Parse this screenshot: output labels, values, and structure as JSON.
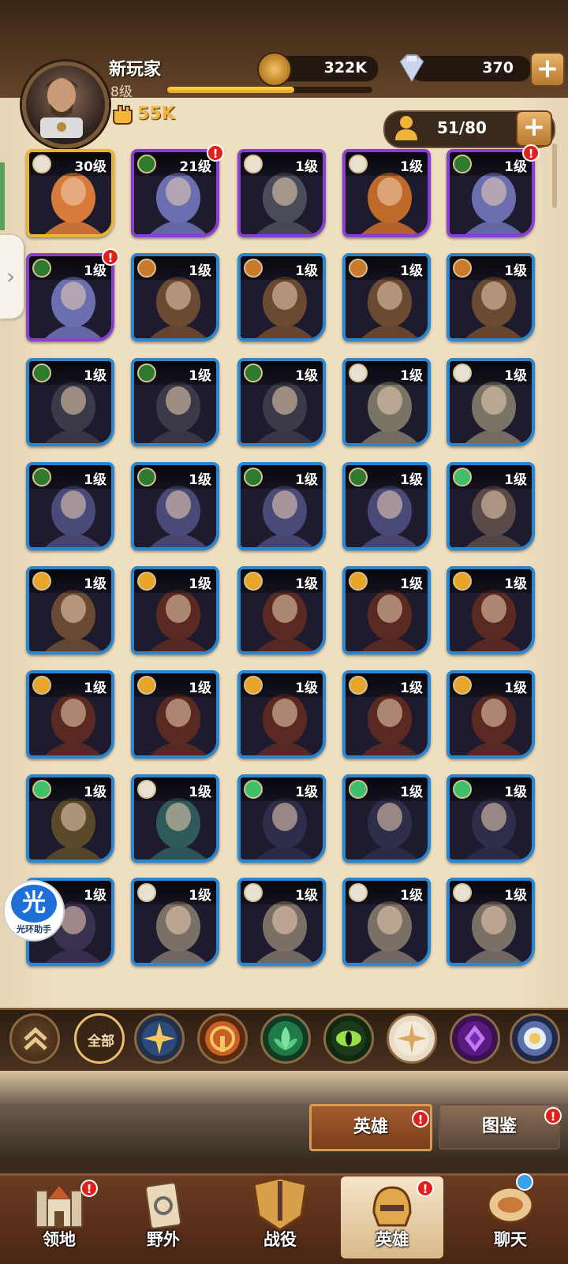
{
  "player": {
    "name": "新玩家",
    "level": "8级",
    "xp_progress": 0.62,
    "power": "55K"
  },
  "resources": {
    "gold": "322K",
    "gems": "370",
    "plus": "+"
  },
  "hero_capacity": "51/80",
  "colors": {
    "blue_frame": "#2b86d0",
    "purple_frame": "#8a3fd0",
    "gold_frame": "#e9b431",
    "panel_bg": "#efdfc1",
    "alert_red": "#e0201c"
  },
  "factions": {
    "lightbearer": {
      "color": "#e8a52a",
      "icon": "sun-cog-icon"
    },
    "wilder": {
      "color": "#3fbf6a",
      "icon": "leaf-icon"
    },
    "graveborn": {
      "color": "#2e7a2e",
      "icon": "eye-icon"
    },
    "maulers": {
      "color": "#c87a2a",
      "icon": "fist-icon"
    },
    "celestial": {
      "color": "#e8e0d0",
      "icon": "star-icon"
    },
    "hypogean": {
      "color": "#8d3fd0",
      "icon": "demon-icon"
    },
    "dimensional": {
      "color": "#5b6fa8",
      "icon": "gear-icon"
    }
  },
  "heroes": [
    {
      "level": "30级",
      "rarity": "gold",
      "faction": "celestial",
      "alert": false,
      "portrait": "#d87a3a"
    },
    {
      "level": "21级",
      "rarity": "purple",
      "faction": "graveborn",
      "alert": true,
      "portrait": "#6b6fb0"
    },
    {
      "level": "1级",
      "rarity": "purple",
      "faction": "celestial",
      "alert": false,
      "portrait": "#4a4d58"
    },
    {
      "level": "1级",
      "rarity": "purple",
      "faction": "celestial",
      "alert": false,
      "portrait": "#c06a2a"
    },
    {
      "level": "1级",
      "rarity": "purple",
      "faction": "graveborn",
      "alert": true,
      "portrait": "#6b6fb0"
    },
    {
      "level": "1级",
      "rarity": "purple",
      "faction": "graveborn",
      "alert": true,
      "portrait": "#6b6fb0"
    },
    {
      "level": "1级",
      "rarity": "blue",
      "faction": "maulers",
      "alert": false,
      "portrait": "#6b4a32"
    },
    {
      "level": "1级",
      "rarity": "blue",
      "faction": "maulers",
      "alert": false,
      "portrait": "#6b4a32"
    },
    {
      "level": "1级",
      "rarity": "blue",
      "faction": "maulers",
      "alert": false,
      "portrait": "#6b4a32"
    },
    {
      "level": "1级",
      "rarity": "blue",
      "faction": "maulers",
      "alert": false,
      "portrait": "#6b4a32"
    },
    {
      "level": "1级",
      "rarity": "blue",
      "faction": "graveborn",
      "alert": false,
      "portrait": "#3a3a48"
    },
    {
      "level": "1级",
      "rarity": "blue",
      "faction": "graveborn",
      "alert": false,
      "portrait": "#3a3a48"
    },
    {
      "level": "1级",
      "rarity": "blue",
      "faction": "graveborn",
      "alert": false,
      "portrait": "#3a3a48"
    },
    {
      "level": "1级",
      "rarity": "blue",
      "faction": "celestial",
      "alert": false,
      "portrait": "#7a7466"
    },
    {
      "level": "1级",
      "rarity": "blue",
      "faction": "celestial",
      "alert": false,
      "portrait": "#7a7466"
    },
    {
      "level": "1级",
      "rarity": "blue",
      "faction": "graveborn",
      "alert": false,
      "portrait": "#4a4a78"
    },
    {
      "level": "1级",
      "rarity": "blue",
      "faction": "graveborn",
      "alert": false,
      "portrait": "#4a4a78"
    },
    {
      "level": "1级",
      "rarity": "blue",
      "faction": "graveborn",
      "alert": false,
      "portrait": "#4a4a78"
    },
    {
      "level": "1级",
      "rarity": "blue",
      "faction": "graveborn",
      "alert": false,
      "portrait": "#4a4a78"
    },
    {
      "level": "1级",
      "rarity": "blue",
      "faction": "wilder",
      "alert": false,
      "portrait": "#5a4a48"
    },
    {
      "level": "1级",
      "rarity": "blue",
      "faction": "lightbearer",
      "alert": false,
      "portrait": "#6a4a34"
    },
    {
      "level": "1级",
      "rarity": "blue",
      "faction": "lightbearer",
      "alert": false,
      "portrait": "#5a2a22"
    },
    {
      "level": "1级",
      "rarity": "blue",
      "faction": "lightbearer",
      "alert": false,
      "portrait": "#5a2a22"
    },
    {
      "level": "1级",
      "rarity": "blue",
      "faction": "lightbearer",
      "alert": false,
      "portrait": "#5a2a22"
    },
    {
      "level": "1级",
      "rarity": "blue",
      "faction": "lightbearer",
      "alert": false,
      "portrait": "#5a2a22"
    },
    {
      "level": "1级",
      "rarity": "blue",
      "faction": "lightbearer",
      "alert": false,
      "portrait": "#5a2a22"
    },
    {
      "level": "1级",
      "rarity": "blue",
      "faction": "lightbearer",
      "alert": false,
      "portrait": "#5a2a22"
    },
    {
      "level": "1级",
      "rarity": "blue",
      "faction": "lightbearer",
      "alert": false,
      "portrait": "#5a2a22"
    },
    {
      "level": "1级",
      "rarity": "blue",
      "faction": "lightbearer",
      "alert": false,
      "portrait": "#5a2a22"
    },
    {
      "level": "1级",
      "rarity": "blue",
      "faction": "lightbearer",
      "alert": false,
      "portrait": "#5a2a22"
    },
    {
      "level": "1级",
      "rarity": "blue",
      "faction": "wilder",
      "alert": false,
      "portrait": "#5a4a2a"
    },
    {
      "level": "1级",
      "rarity": "blue",
      "faction": "celestial",
      "alert": false,
      "portrait": "#2e5a5a"
    },
    {
      "level": "1级",
      "rarity": "blue",
      "faction": "wilder",
      "alert": false,
      "portrait": "#2e2e4a"
    },
    {
      "level": "1级",
      "rarity": "blue",
      "faction": "wilder",
      "alert": false,
      "portrait": "#2e2e4a"
    },
    {
      "level": "1级",
      "rarity": "blue",
      "faction": "wilder",
      "alert": false,
      "portrait": "#2e2e4a"
    },
    {
      "level": "1级",
      "rarity": "blue",
      "faction": "wilder",
      "alert": false,
      "portrait": "#3a3050"
    },
    {
      "level": "1级",
      "rarity": "blue",
      "faction": "celestial",
      "alert": false,
      "portrait": "#7a7066"
    },
    {
      "level": "1级",
      "rarity": "blue",
      "faction": "celestial",
      "alert": false,
      "portrait": "#7a7066"
    },
    {
      "level": "1级",
      "rarity": "blue",
      "faction": "celestial",
      "alert": false,
      "portrait": "#7a7066"
    },
    {
      "level": "1级",
      "rarity": "blue",
      "faction": "celestial",
      "alert": false,
      "portrait": "#7a7066"
    }
  ],
  "filters": {
    "all_label": "全部",
    "items": [
      "lightbearer-star",
      "maulers",
      "wilder",
      "graveborn",
      "celestial",
      "hypogean",
      "dimensional"
    ]
  },
  "assistant": {
    "badge": "光",
    "label": "光环助手"
  },
  "subtabs": {
    "heroes": "英雄",
    "codex": "图鉴"
  },
  "bottom_nav": [
    {
      "label": "领地",
      "icon": "castle-icon",
      "alert": true
    },
    {
      "label": "野外",
      "icon": "map-scroll-icon",
      "alert": false
    },
    {
      "label": "战役",
      "icon": "sword-crest-icon",
      "alert": false
    },
    {
      "label": "英雄",
      "icon": "helmet-icon",
      "alert": true,
      "active": true
    },
    {
      "label": "聊天",
      "icon": "chat-bubble-icon",
      "alert": false
    }
  ]
}
